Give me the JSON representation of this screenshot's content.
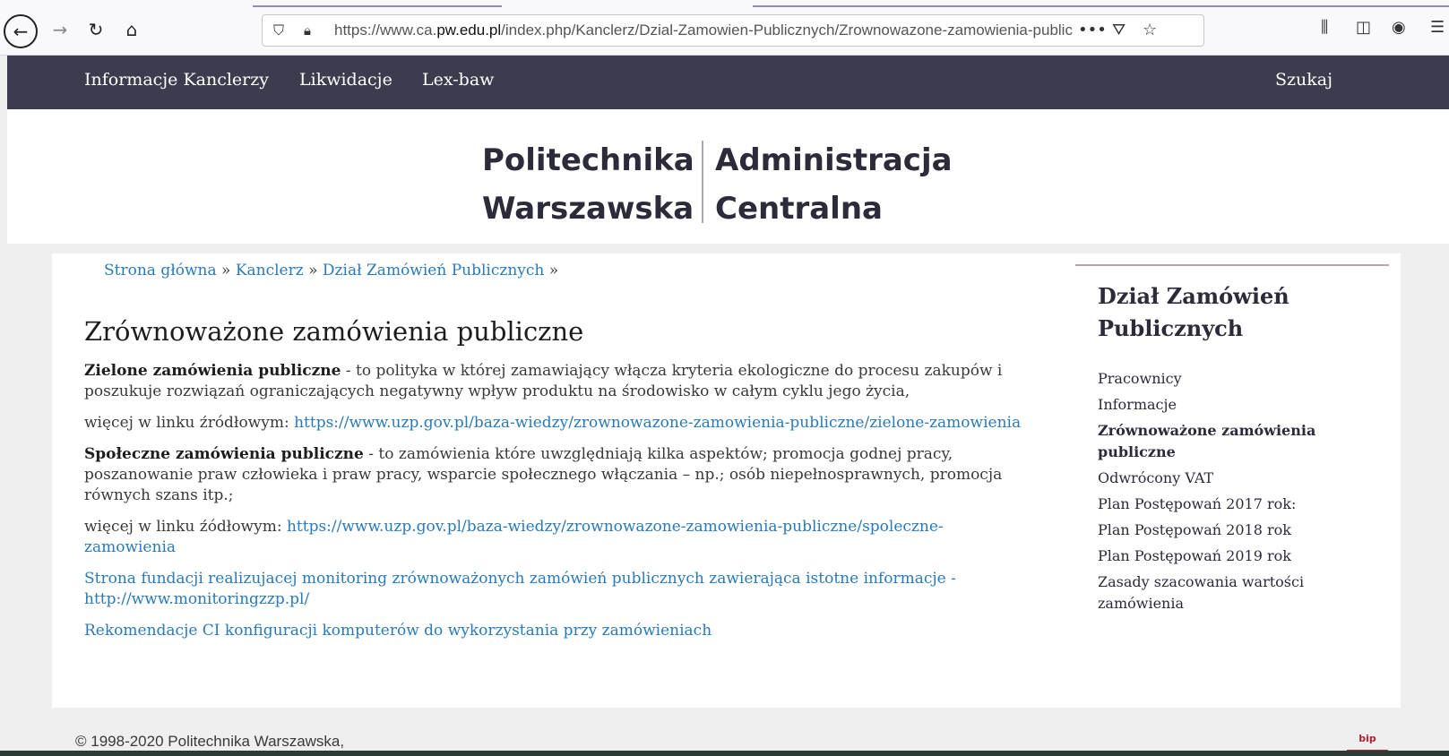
{
  "browser": {
    "url_prefix": "https://www.ca.",
    "url_domain": "pw.edu.pl",
    "url_path": "/index.php/Kanclerz/Dzial-Zamowien-Publicznych/Zrownowazone-zamowienia-public",
    "icons": {
      "back": "back-arrow-icon",
      "forward": "forward-arrow-icon",
      "reload": "reload-icon",
      "home": "home-icon",
      "shield": "shield-icon",
      "lock": "lock-icon",
      "more": "more-icon",
      "pocket": "pocket-icon",
      "bookmark": "star-icon",
      "library": "library-icon",
      "sidebar": "sidebar-icon",
      "account": "account-icon",
      "menu": "menu-icon"
    }
  },
  "nav": {
    "items": [
      "Informacje Kanclerzy",
      "Likwidacje",
      "Lex-baw"
    ],
    "search": "Szukaj"
  },
  "logo": {
    "line1_left": "Politechnika",
    "line2_left": "Warszawska",
    "line1_right": "Administracja",
    "line2_right": "Centralna"
  },
  "breadcrumb": {
    "home": "Strona główna",
    "sep": "»",
    "kanclerz": "Kanclerz",
    "dzial": "Dział Zamówień Publicznych"
  },
  "page": {
    "title": "Zrównoważone zamówienia publiczne",
    "p1_bold": "Zielone zamówienia publiczne",
    "p1_text": " - to polityka w której zamawiający włącza kryteria ekologiczne do procesu zakupów i poszukuje rozwiązań ograniczających negatywny wpływ produktu na środowisko w całym cyklu jego życia,",
    "p2_text": "więcej w linku źródłowym: ",
    "p2_link": "https://www.uzp.gov.pl/baza-wiedzy/zrownowazone-zamowienia-publiczne/zielone-zamowienia",
    "p3_bold": "Społeczne zamówienia publiczne",
    "p3_text": " - to zamówienia które uwzględniają kilka aspektów; promocja godnej pracy, poszanowanie praw człowieka i praw pracy, wsparcie społecznego włączania – np.; osób niepełnosprawnych, promocja równych szans itp.;",
    "p4_text": "więcej w linku źódłowym: ",
    "p4_link": "https://www.uzp.gov.pl/baza-wiedzy/zrownowazone-zamowienia-publiczne/spoleczne-zamowienia",
    "p5_link": "Strona fundacji realizujacej monitoring zrównoważonych zamówień publicznych zawierająca istotne informacje - http://www.monitoringzzp.pl/",
    "p6_link": "Rekomendacje CI konfiguracji komputerów do wykorzystania przy zamówieniach"
  },
  "sidebar": {
    "title": "Dział Zamówień Publicznych",
    "items": [
      "Pracownicy",
      "Informacje",
      "Zrównoważone zamówienia publiczne",
      "Odwrócony VAT",
      "Plan Postępowań 2017 rok:",
      "Plan Postępowań 2018 rok",
      "Plan Postępowań 2019 rok",
      "Zasady szacowania wartości zamówienia"
    ]
  },
  "footer": {
    "copyright": "© 1998-2020 Politechnika Warszawska,",
    "bip_label": "bip"
  },
  "colors": {
    "nav_bg": "#3c3c4e",
    "link": "#2a7ab9",
    "bip_red": "#b51f2e"
  }
}
